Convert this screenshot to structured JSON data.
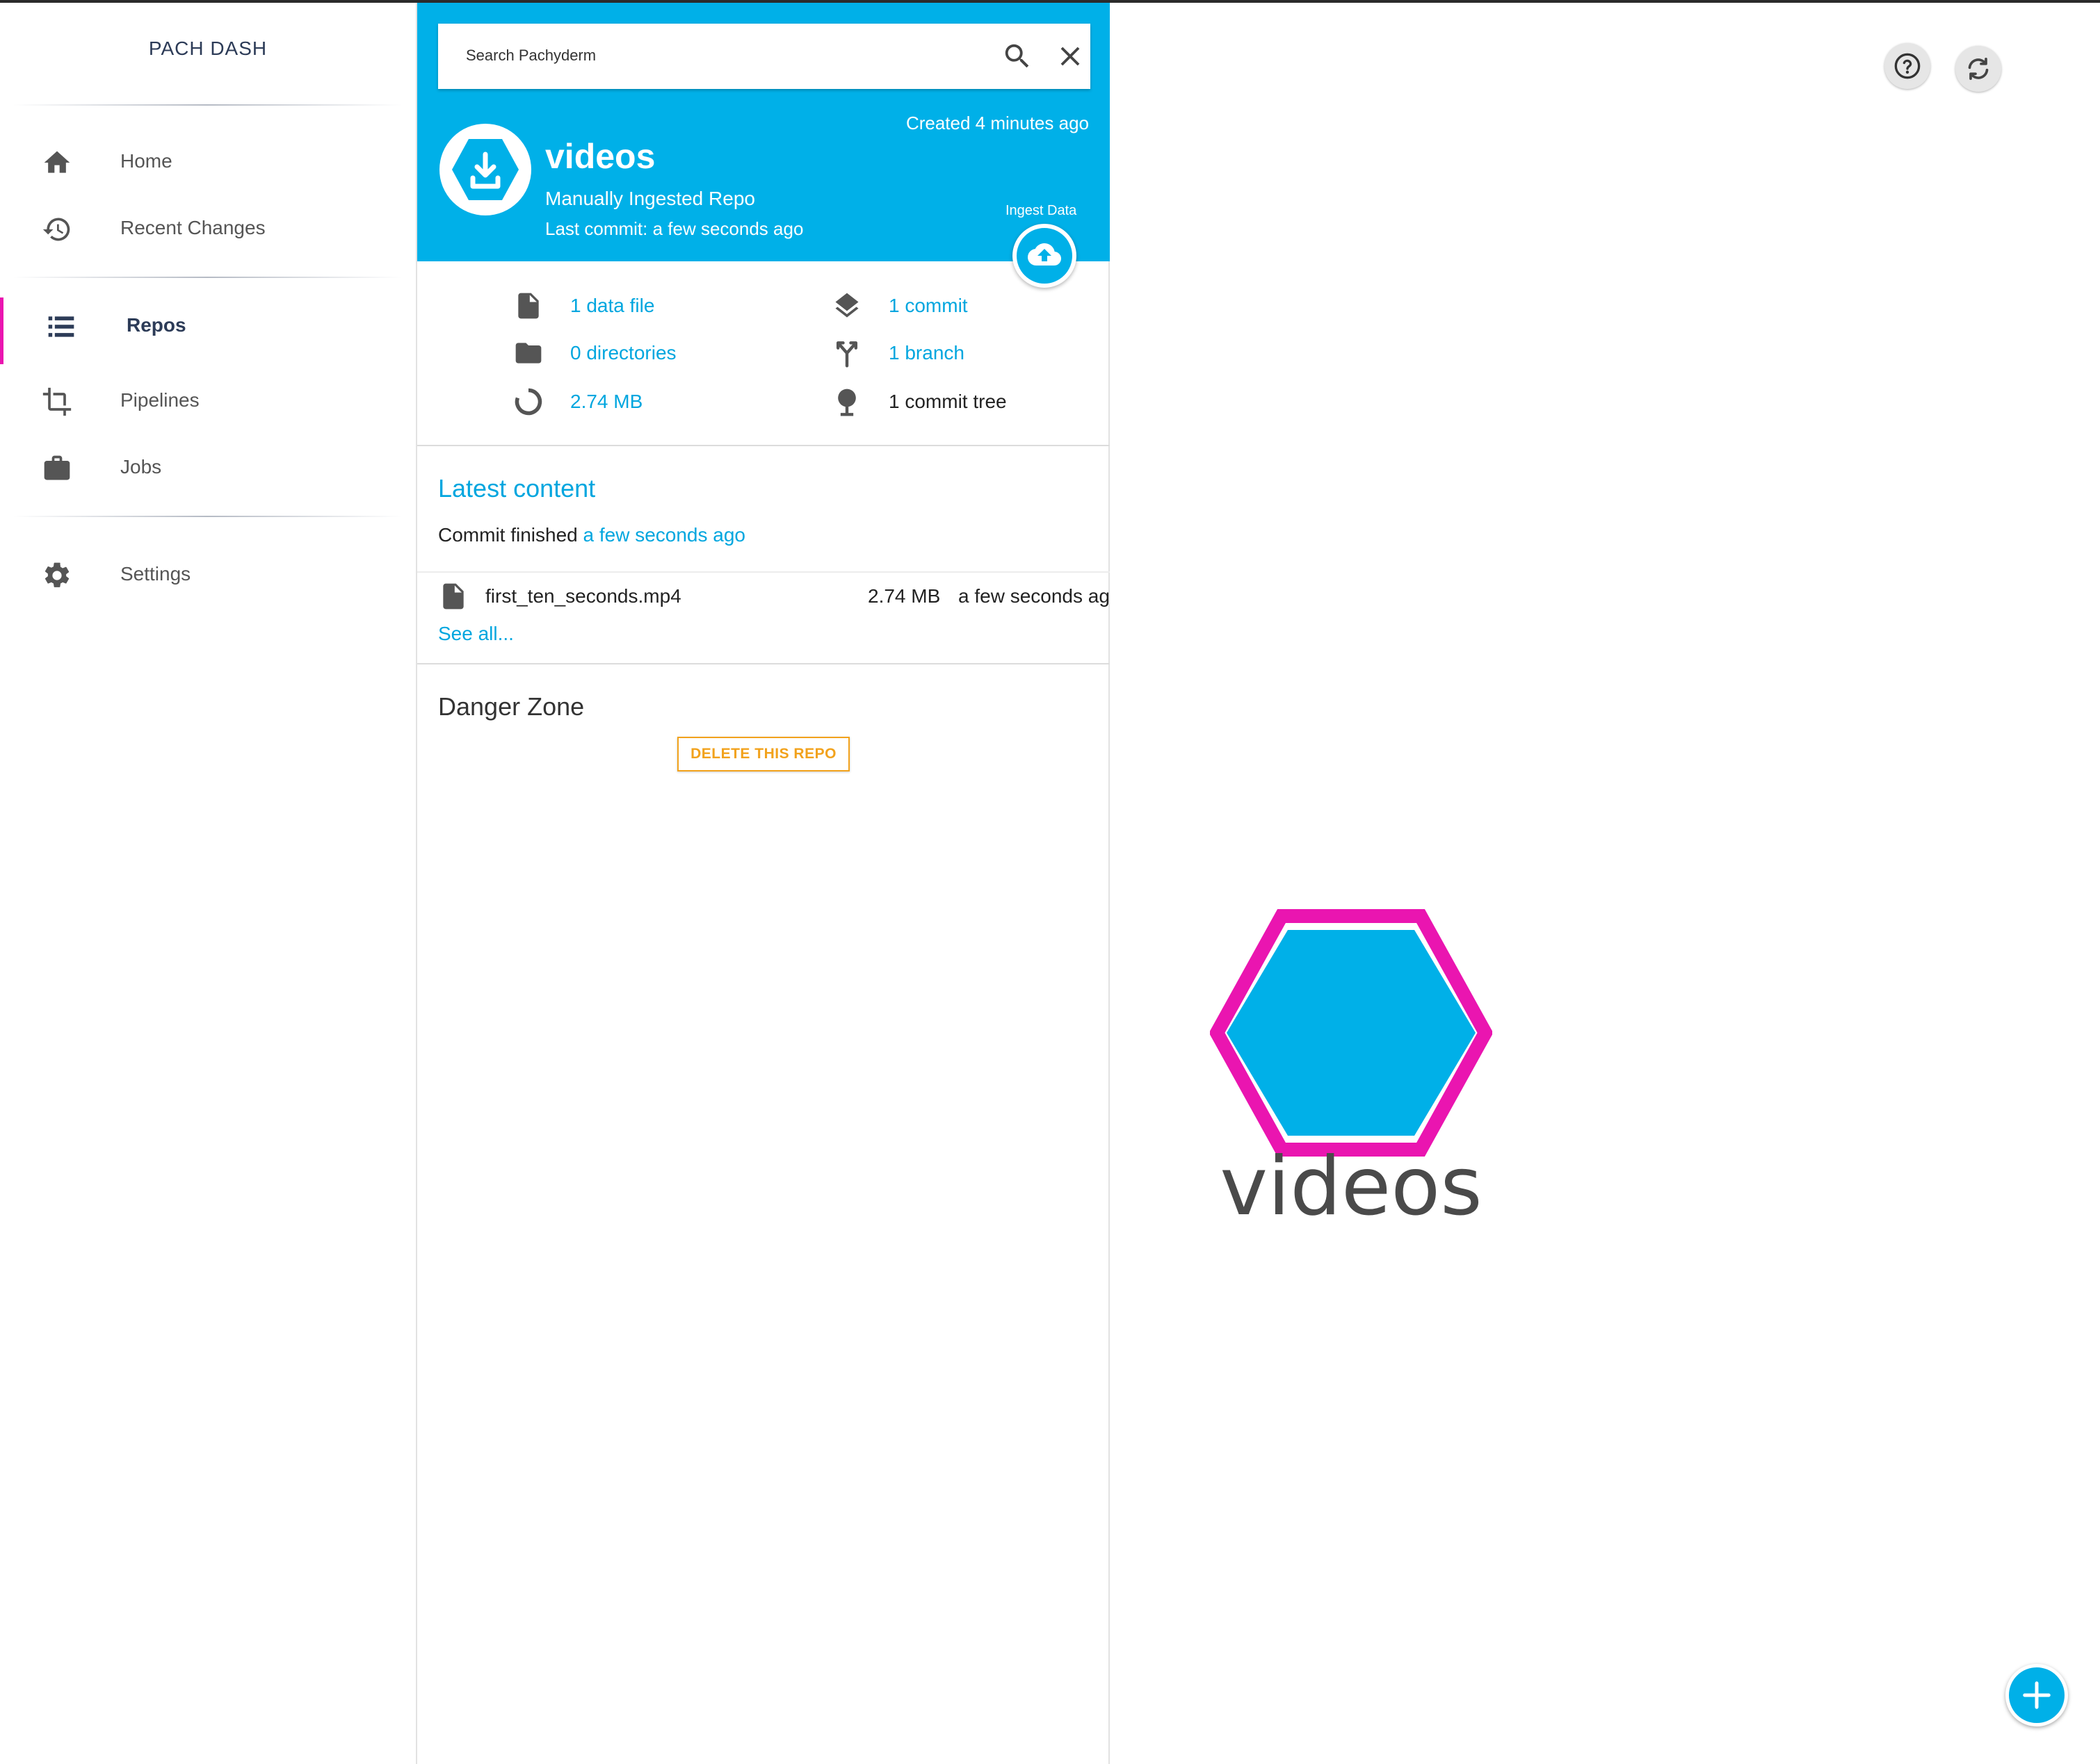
{
  "sidebar": {
    "brand": "PACH DASH",
    "items": [
      {
        "label": "Home",
        "icon": "home-icon"
      },
      {
        "label": "Recent Changes",
        "icon": "history-icon"
      },
      {
        "label": "Repos",
        "icon": "list-icon",
        "active": true
      },
      {
        "label": "Pipelines",
        "icon": "crop-icon"
      },
      {
        "label": "Jobs",
        "icon": "briefcase-icon"
      },
      {
        "label": "Settings",
        "icon": "gear-icon"
      }
    ]
  },
  "search": {
    "placeholder": "Search Pachyderm"
  },
  "repo": {
    "created": "Created 4 minutes ago",
    "name": "videos",
    "type": "Manually Ingested Repo",
    "last_commit": "Last commit: a few seconds ago",
    "ingest_label": "Ingest Data"
  },
  "stats": {
    "data_files": "1 data file",
    "directories": "0 directories",
    "size": "2.74 MB",
    "commits": "1 commit",
    "branches": "1 branch",
    "commit_trees": "1 commit tree"
  },
  "latest": {
    "title": "Latest content",
    "commit_prefix": "Commit finished",
    "commit_time": "a few seconds ago",
    "files": [
      {
        "name": "first_ten_seconds.mp4",
        "size": "2.74 MB",
        "time": "a few seconds ag"
      }
    ],
    "see_all": "See all..."
  },
  "danger": {
    "title": "Danger Zone",
    "delete_label": "DELETE THIS REPO"
  },
  "canvas": {
    "node_label": "videos"
  },
  "colors": {
    "accent": "#00b0e8",
    "link": "#00a6df",
    "highlight": "#ea15b0",
    "warning": "#f2a21c",
    "nav_text": "#2c3b57"
  }
}
